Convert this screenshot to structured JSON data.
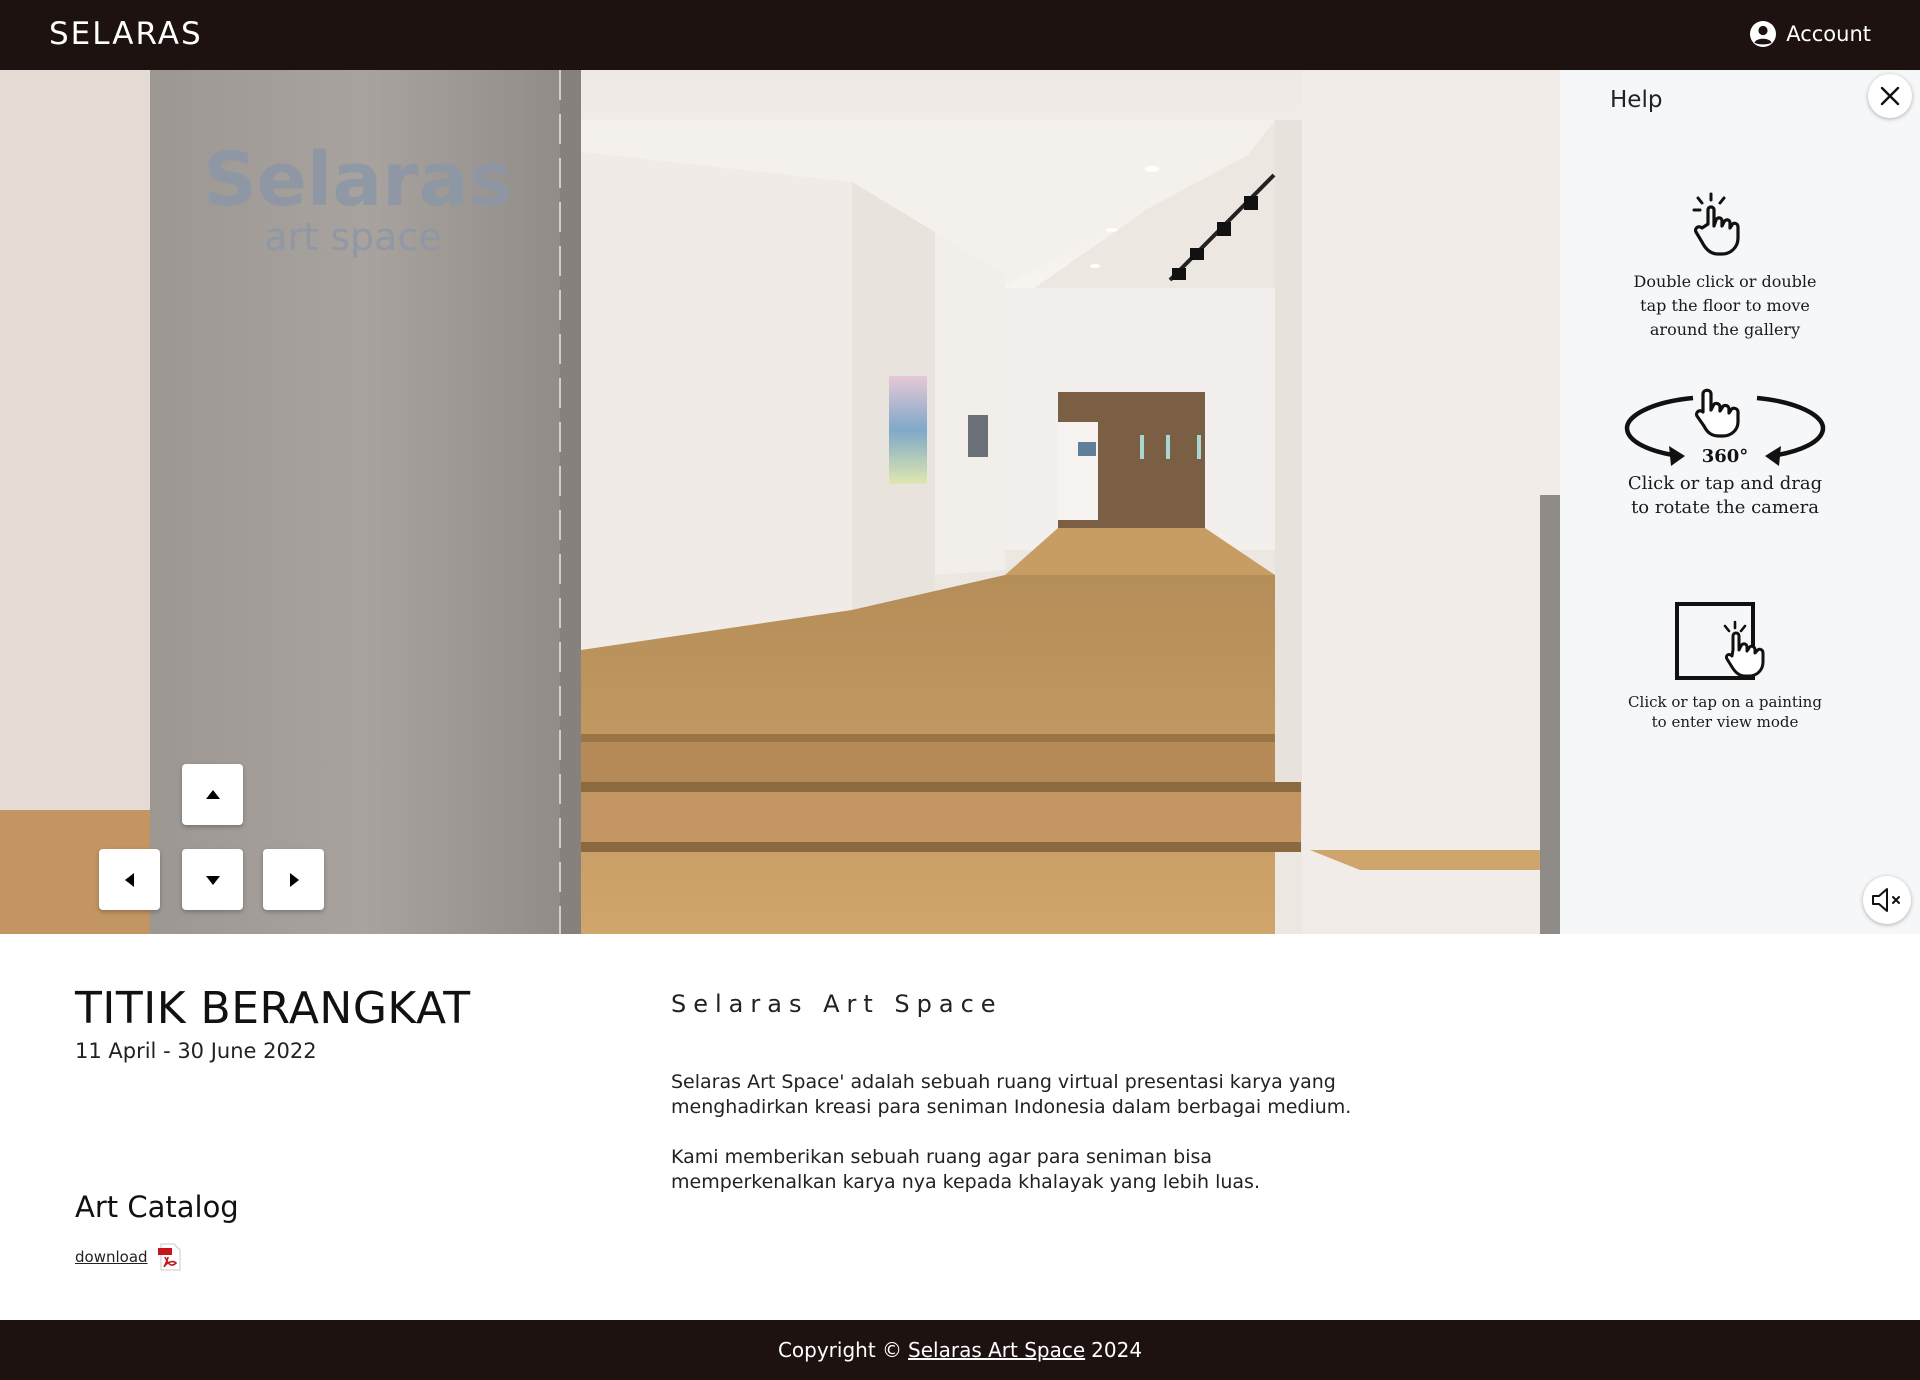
{
  "header": {
    "brand": "SELARAS",
    "account_label": "Account"
  },
  "viewport": {
    "wall_sign_main": "Selaras",
    "wall_sign_sub": "art space",
    "nav_icons": [
      "arrow-up-icon",
      "arrow-left-icon",
      "arrow-down-icon",
      "arrow-right-icon"
    ]
  },
  "help": {
    "title": "Help",
    "items": [
      {
        "icon": "double-tap-hand-icon",
        "text": "Double click or double tap the floor to move around the gallery"
      },
      {
        "icon": "rotate-360-hand-icon",
        "label": "360°",
        "text": "Click or tap and drag to rotate the camera"
      },
      {
        "icon": "tap-painting-icon",
        "text": "Click or tap on a painting to enter view mode"
      }
    ],
    "mute_icon": "speaker-muted-icon"
  },
  "exhibition": {
    "title": "TITIK BERANGKAT",
    "dates": "11 April - 30 June 2022",
    "catalog_title": "Art Catalog",
    "download_label": "download"
  },
  "about": {
    "title": "Selaras Art Space",
    "paragraphs": [
      "Selaras Art Space' adalah sebuah ruang virtual presentasi karya yang menghadirkan kreasi para seniman Indonesia dalam berbagai medium.",
      "Kami memberikan sebuah ruang agar para seniman bisa memperkenalkan karya nya kepada khalayak yang lebih luas."
    ]
  },
  "footer": {
    "prefix": "Copyright ©",
    "link": "Selaras Art Space",
    "year": "2024"
  },
  "colors": {
    "bar": "#1e1211",
    "panel": "#f6f7f9",
    "wood": "#c49a62",
    "wall": "#ece6e1",
    "concrete": "#a19c97"
  }
}
